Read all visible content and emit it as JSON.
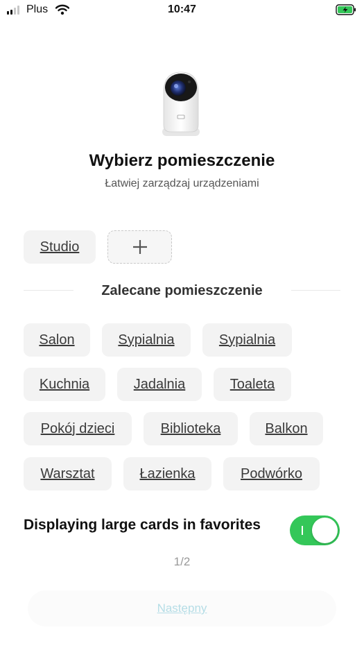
{
  "status_bar": {
    "carrier": "Plus",
    "time": "10:47"
  },
  "header": {
    "title": "Wybierz pomieszczenie",
    "subtitle": "Łatwiej zarządzaj urządzeniami"
  },
  "existing_rooms": [
    "Studio"
  ],
  "recommended": {
    "title": "Zalecane pomieszczenie",
    "rooms": [
      "Salon",
      "Sypialnia",
      "Sypialnia",
      "Kuchnia",
      "Jadalnia",
      "Toaleta",
      "Pokój dzieci",
      "Biblioteka",
      "Balkon",
      "Warsztat",
      "Łazienka",
      "Podwórko"
    ]
  },
  "favorites": {
    "label": "Displaying large cards in favorites",
    "enabled": true
  },
  "pager": "1/2",
  "next_button": "Następny",
  "colors": {
    "toggle_on": "#34c759",
    "chip_bg": "#f3f3f3",
    "next_text": "#b5dde6"
  }
}
